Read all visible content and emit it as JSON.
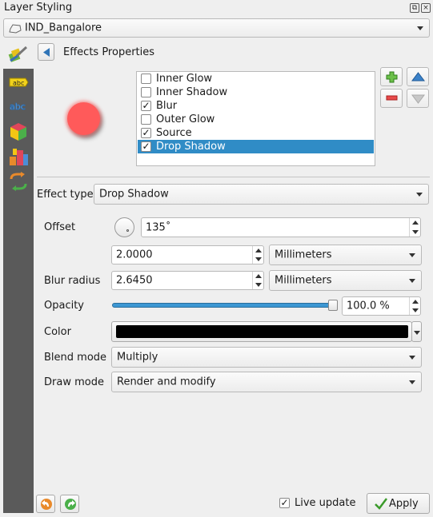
{
  "window": {
    "title": "Layer Styling",
    "float_icon": "float-icon",
    "close_icon": "close-icon"
  },
  "layer_selector": {
    "value": "IND_Bangalore",
    "icon": "polygon-layer-icon"
  },
  "header": {
    "title": "Effects Properties",
    "back_icon": "back-arrow-icon",
    "paint_icon": "paintbrush-icon"
  },
  "sidebar": {
    "items": [
      {
        "name": "labels",
        "icon": "label-abc-yellow-icon"
      },
      {
        "name": "masks",
        "icon": "label-abc-outline-icon"
      },
      {
        "name": "3d-view",
        "icon": "3d-cube-icon"
      },
      {
        "name": "diagrams",
        "icon": "diagram-icon"
      },
      {
        "name": "history",
        "icon": "history-icon"
      }
    ]
  },
  "effects": {
    "list": [
      {
        "label": "Inner Glow",
        "checked": false,
        "selected": false
      },
      {
        "label": "Inner Shadow",
        "checked": false,
        "selected": false
      },
      {
        "label": "Blur",
        "checked": true,
        "selected": false
      },
      {
        "label": "Outer Glow",
        "checked": false,
        "selected": false
      },
      {
        "label": "Source",
        "checked": true,
        "selected": false
      },
      {
        "label": "Drop Shadow",
        "checked": true,
        "selected": true
      }
    ],
    "check_glyph": "✓",
    "add_icon": "add-effect-icon",
    "remove_icon": "remove-effect-icon",
    "up_icon": "move-up-icon",
    "down_icon": "move-down-icon"
  },
  "effect_type": {
    "label": "Effect type",
    "value": "Drop Shadow"
  },
  "props": {
    "offset_label": "Offset",
    "angle_value": "135˚",
    "distance_value": "2.0000",
    "distance_unit": "Millimeters",
    "blur_label": "Blur radius",
    "blur_value": "2.6450",
    "blur_unit": "Millimeters",
    "opacity_label": "Opacity",
    "opacity_value": "100.0 %",
    "opacity_fraction": 1.0,
    "color_label": "Color",
    "color_value": "#000000",
    "blend_label": "Blend mode",
    "blend_value": "Multiply",
    "draw_label": "Draw mode",
    "draw_value": "Render and modify"
  },
  "preview": {
    "fill_color": "#ff5a5a"
  },
  "footer": {
    "undo_icon": "undo-icon",
    "redo_icon": "redo-icon",
    "live_update_label": "Live update",
    "live_update_checked": true,
    "apply_label": "Apply"
  }
}
